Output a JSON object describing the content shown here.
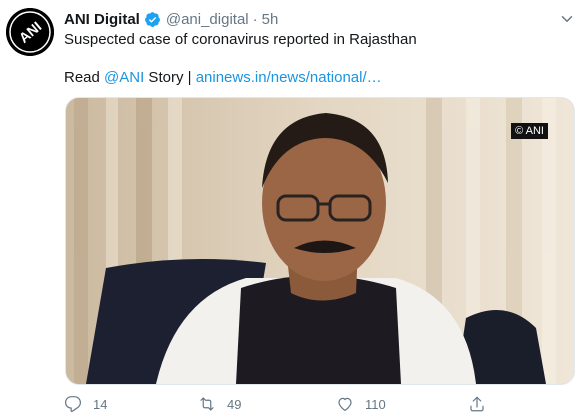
{
  "tweet": {
    "author_name": "ANI Digital",
    "author_handle": "@ani_digital",
    "separator": "·",
    "time": "5h",
    "line1": "Suspected case of coronavirus reported in Rajasthan",
    "line2_prefix": "Read ",
    "mention": "@ANI",
    "line2_middle": " Story | ",
    "url_text": "aninews.in/news/national/…",
    "media_watermark": "© ANI",
    "avatar_text": "ANI"
  },
  "actions": {
    "reply_count": "14",
    "retweet_count": "49",
    "like_count": "110"
  },
  "colors": {
    "link": "#1b95e0",
    "muted": "#657786",
    "verified": "#1da1f2"
  },
  "icons": [
    "verified-badge-icon",
    "chevron-down-icon",
    "reply-icon",
    "retweet-icon",
    "like-icon",
    "share-icon"
  ]
}
